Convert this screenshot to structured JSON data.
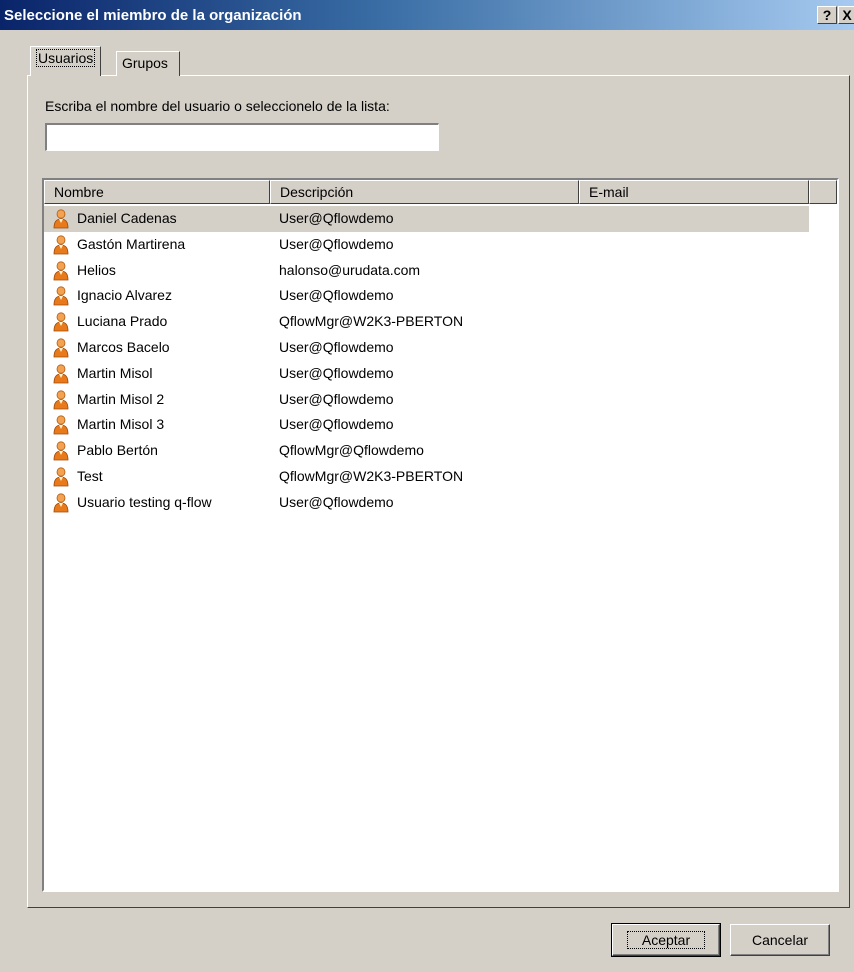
{
  "window": {
    "title": "Seleccione el miembro de la organización",
    "help_label": "?",
    "close_label": "X"
  },
  "tabs": [
    {
      "label": "Usuarios",
      "active": true
    },
    {
      "label": "Grupos",
      "active": false
    }
  ],
  "search": {
    "prompt": "Escriba el nombre del usuario o seleccionelo de la lista:",
    "value": "",
    "placeholder": ""
  },
  "list": {
    "columns": [
      "Nombre",
      "Descripción",
      "E-mail"
    ],
    "rows": [
      {
        "name": "Daniel Cadenas",
        "description": "User@Qflowdemo",
        "email": "",
        "selected": true
      },
      {
        "name": "Gastón Martirena",
        "description": "User@Qflowdemo",
        "email": "",
        "selected": false
      },
      {
        "name": "Helios",
        "description": "halonso@urudata.com",
        "email": "",
        "selected": false
      },
      {
        "name": "Ignacio Alvarez",
        "description": "User@Qflowdemo",
        "email": "",
        "selected": false
      },
      {
        "name": "Luciana Prado",
        "description": "QflowMgr@W2K3-PBERTON",
        "email": "",
        "selected": false
      },
      {
        "name": "Marcos Bacelo",
        "description": "User@Qflowdemo",
        "email": "",
        "selected": false
      },
      {
        "name": "Martin Misol",
        "description": "User@Qflowdemo",
        "email": "",
        "selected": false
      },
      {
        "name": "Martin Misol 2",
        "description": "User@Qflowdemo",
        "email": "",
        "selected": false
      },
      {
        "name": "Martin Misol 3",
        "description": "User@Qflowdemo",
        "email": "",
        "selected": false
      },
      {
        "name": "Pablo Bertón",
        "description": "QflowMgr@Qflowdemo",
        "email": "",
        "selected": false
      },
      {
        "name": "Test",
        "description": "QflowMgr@W2K3-PBERTON",
        "email": "",
        "selected": false
      },
      {
        "name": "Usuario testing q-flow",
        "description": "User@Qflowdemo",
        "email": "",
        "selected": false
      }
    ],
    "row_icon": "user-icon"
  },
  "buttons": {
    "ok_label": "Aceptar",
    "cancel_label": "Cancelar"
  },
  "colors": {
    "titlebar_start": "#0a246a",
    "titlebar_end": "#a6caf0",
    "dialog_face": "#d4d0c8",
    "user_icon": "#e87a1c"
  }
}
